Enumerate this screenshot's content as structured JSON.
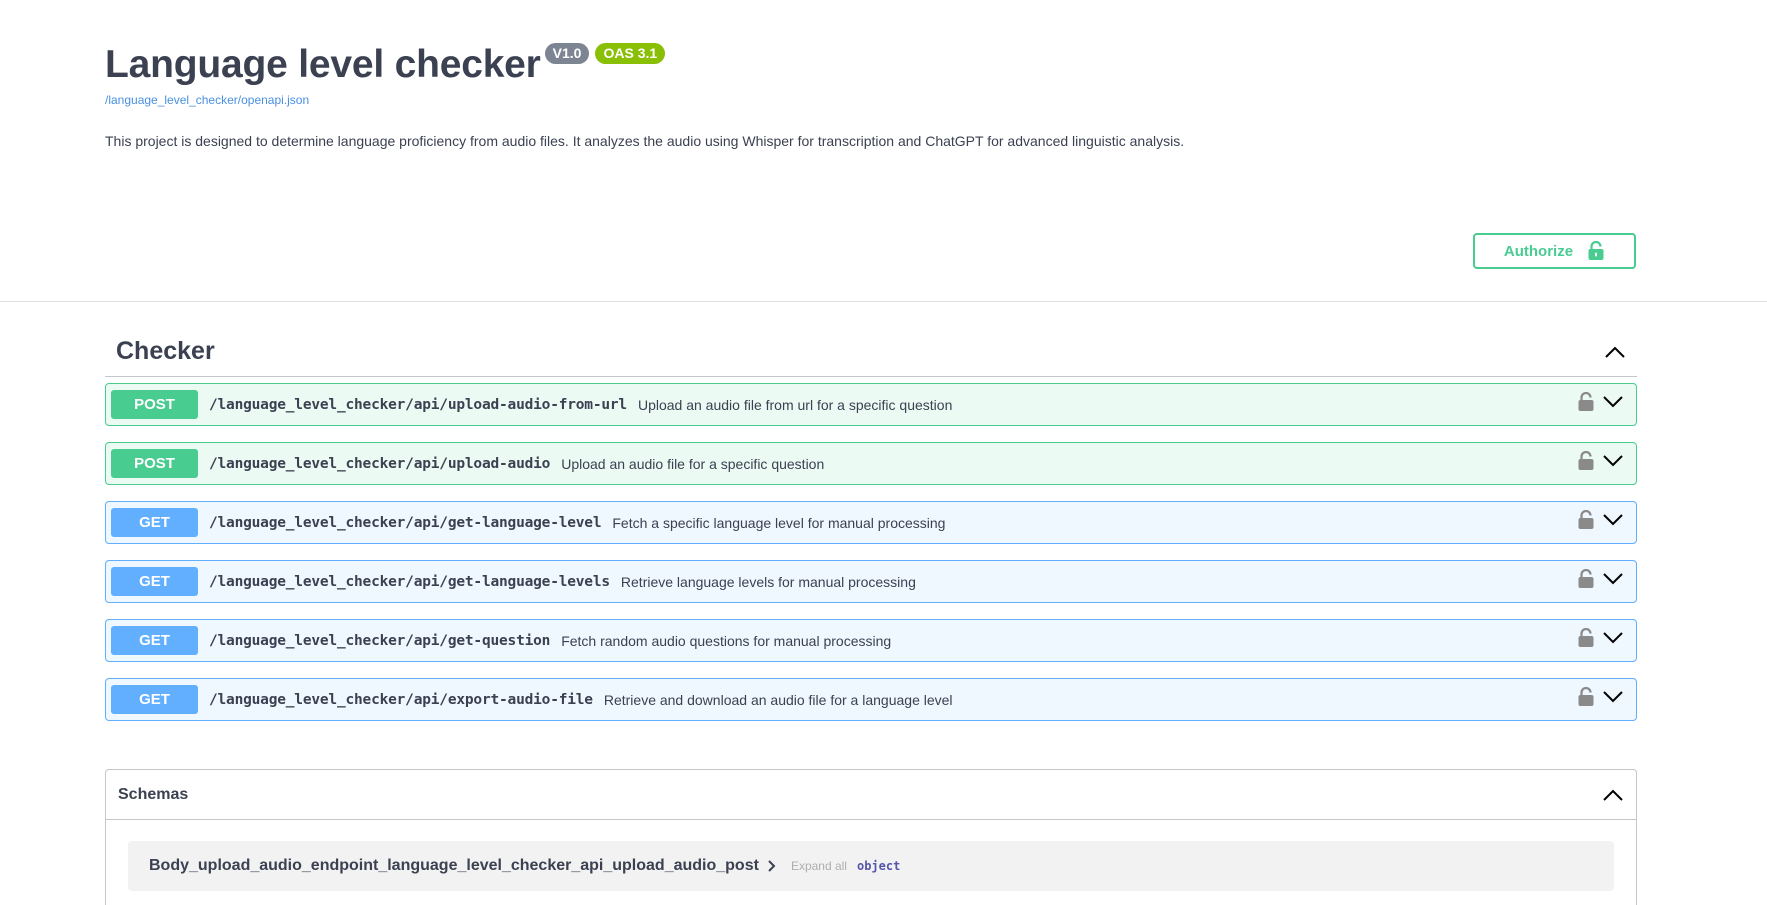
{
  "info": {
    "title": "Language level checker",
    "version_badge": "V1.0",
    "oas_badge": "OAS 3.1",
    "spec_link": "/language_level_checker/openapi.json",
    "description": "This project is designed to determine language proficiency from audio files. It analyzes the audio using Whisper for transcription and ChatGPT for advanced linguistic analysis."
  },
  "authorize": {
    "label": "Authorize",
    "icon": "unlock-icon",
    "color": "#49cc90"
  },
  "tag": {
    "name": "Checker",
    "icon": "chevron-up-icon"
  },
  "operations": [
    {
      "method": "POST",
      "path": "/language_level_checker/api/upload-audio-from-url",
      "summary": "Upload an audio file from url for a specific question"
    },
    {
      "method": "POST",
      "path": "/language_level_checker/api/upload-audio",
      "summary": "Upload an audio file for a specific question"
    },
    {
      "method": "GET",
      "path": "/language_level_checker/api/get-language-level",
      "summary": "Fetch a specific language level for manual processing"
    },
    {
      "method": "GET",
      "path": "/language_level_checker/api/get-language-levels",
      "summary": "Retrieve language levels for manual processing"
    },
    {
      "method": "GET",
      "path": "/language_level_checker/api/get-question",
      "summary": "Fetch random audio questions for manual processing"
    },
    {
      "method": "GET",
      "path": "/language_level_checker/api/export-audio-file",
      "summary": "Retrieve and download an audio file for a language level"
    }
  ],
  "colors": {
    "post": "#49cc90",
    "get": "#61affe",
    "version_badge": "#7d8492",
    "oas_badge": "#89bf04"
  },
  "schemas": {
    "title": "Schemas",
    "items": [
      {
        "name": "Body_upload_audio_endpoint_language_level_checker_api_upload_audio_post",
        "expand_label": "Expand all",
        "type": "object"
      }
    ]
  }
}
